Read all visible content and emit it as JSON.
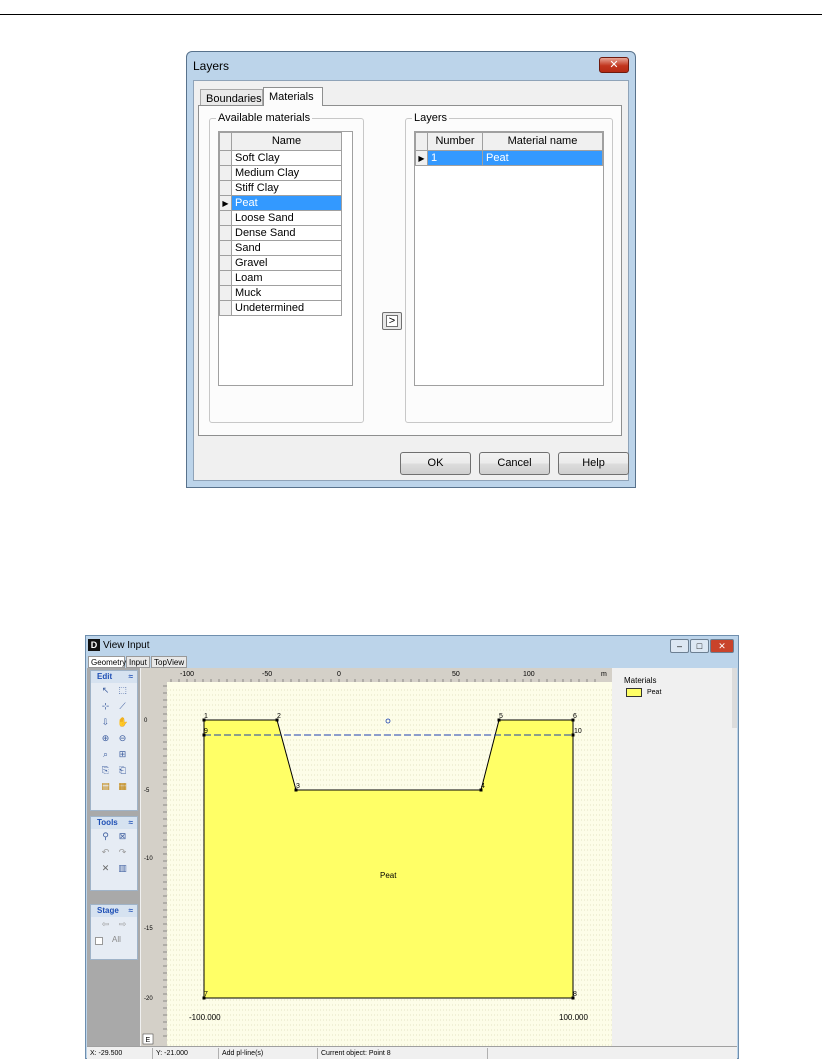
{
  "layers_dialog": {
    "title": "Layers",
    "close_symbol": "✕",
    "tabs": [
      "Boundaries",
      "Materials"
    ],
    "available_materials": {
      "legend": "Available materials",
      "header": "Name",
      "selected": "Peat",
      "items": [
        "Soft Clay",
        "Medium Clay",
        "Stiff Clay",
        "Peat",
        "Loose Sand",
        "Dense Sand",
        "Sand",
        "Gravel",
        "Loam",
        "Muck",
        "Undetermined"
      ]
    },
    "add_arrow": ">",
    "layers": {
      "legend": "Layers",
      "headers": [
        "Number",
        "Material name"
      ],
      "rows": [
        {
          "number": "1",
          "material": "Peat"
        }
      ]
    },
    "buttons": {
      "ok": "OK",
      "cancel": "Cancel",
      "help": "Help"
    }
  },
  "view_input": {
    "title": "View Input",
    "logo": "D",
    "window_buttons": {
      "minimize": "–",
      "maximize": "□",
      "close": "✕"
    },
    "tabs": [
      "Geometry",
      "Input",
      "TopView"
    ],
    "toolboxes": [
      {
        "title": "Edit",
        "icons": [
          "select-icon",
          "select-region-icon",
          "add-point-icon",
          "add-line-icon",
          "pan-down-icon",
          "hand-icon",
          "zoom-in-icon",
          "zoom-out-icon",
          "zoom-limits-icon",
          "measure-icon",
          "copy-icon",
          "paste-icon",
          "layer-icon",
          "grid-icon"
        ]
      },
      {
        "title": "Tools",
        "icons": [
          "tool-a-icon",
          "tool-b-icon",
          "undo-icon",
          "redo-icon",
          "delete-icon",
          "table-icon"
        ]
      },
      {
        "title": "Stage",
        "icons": [
          "stage-left-icon",
          "stage-right-icon"
        ],
        "checkbox_label": "All"
      }
    ],
    "ruler": {
      "x_ticks": [
        "-100",
        "-50",
        "0",
        "50",
        "100"
      ],
      "x_unit": "m",
      "y_ticks": [
        "0",
        "-5",
        "-10",
        "-15",
        "-20"
      ],
      "corner": "E"
    },
    "geometry": {
      "point_labels": [
        "1",
        "2",
        "3",
        "4",
        "5",
        "6",
        "7",
        "8",
        "9",
        "10"
      ],
      "layer_label": "Peat",
      "left_bound": "-100.000",
      "right_bound": "100.000",
      "fill_color": "#ffff66",
      "phreatic_color": "#1a3fb0"
    },
    "materials_panel": {
      "title": "Materials",
      "items": [
        {
          "name": "Peat",
          "color": "#ffff66"
        }
      ]
    },
    "status": {
      "x": "X: -29.500",
      "y": "Y: -21.000",
      "mode": "Add pl-line(s)",
      "object": "Current object: Point 8"
    }
  }
}
